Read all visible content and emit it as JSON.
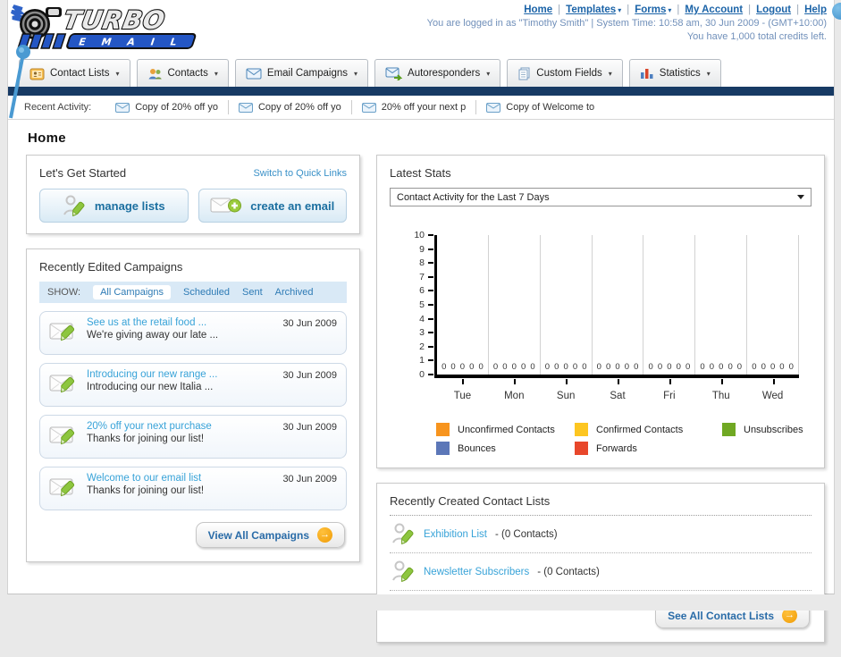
{
  "logo": {
    "line1": "TURBO",
    "line2": "E M A I L"
  },
  "header": {
    "links": [
      {
        "label": "Home",
        "dropdown": false
      },
      {
        "label": "Templates",
        "dropdown": true
      },
      {
        "label": "Forms",
        "dropdown": true
      },
      {
        "label": "My Account",
        "dropdown": false
      },
      {
        "label": "Logout",
        "dropdown": false
      },
      {
        "label": "Help",
        "dropdown": false
      }
    ],
    "login_info": "You are logged in as \"Timothy Smith\" | System Time: 10:58 am, 30 Jun 2009 - (GMT+10:00)",
    "credits": "You have 1,000 total credits left."
  },
  "nav": {
    "tabs": [
      {
        "label": "Contact Lists",
        "icon": "contact-lists-icon"
      },
      {
        "label": "Contacts",
        "icon": "contacts-icon"
      },
      {
        "label": "Email Campaigns",
        "icon": "email-campaigns-icon"
      },
      {
        "label": "Autoresponders",
        "icon": "autoresponders-icon"
      },
      {
        "label": "Custom Fields",
        "icon": "custom-fields-icon"
      },
      {
        "label": "Statistics",
        "icon": "statistics-icon"
      }
    ]
  },
  "recent_activity": {
    "label": "Recent Activity:",
    "items": [
      "Copy of 20% off yo",
      "Copy of 20% off yo",
      "20% off your next p",
      "Copy of Welcome to"
    ]
  },
  "home": {
    "title": "Home"
  },
  "get_started": {
    "title": "Let's Get Started",
    "switch_link": "Switch to Quick Links",
    "buttons": [
      {
        "label": "manage lists",
        "icon": "manage-lists-icon"
      },
      {
        "label": "create an email",
        "icon": "create-email-icon"
      }
    ]
  },
  "campaigns": {
    "title": "Recently Edited Campaigns",
    "show_label": "SHOW:",
    "filters": [
      {
        "label": "All Campaigns",
        "active": true
      },
      {
        "label": "Scheduled",
        "active": false
      },
      {
        "label": "Sent",
        "active": false
      },
      {
        "label": "Archived",
        "active": false
      }
    ],
    "items": [
      {
        "title": "See us at the retail food ...",
        "subtitle": "We're giving away our late ...",
        "date": "30 Jun 2009"
      },
      {
        "title": "Introducing our new range ...",
        "subtitle": "Introducing our new Italia ...",
        "date": "30 Jun 2009"
      },
      {
        "title": "20% off your next purchase",
        "subtitle": "Thanks for joining our list!",
        "date": "30 Jun 2009"
      },
      {
        "title": "Welcome to our email list",
        "subtitle": "Thanks for joining our list!",
        "date": "30 Jun 2009"
      }
    ],
    "view_all_label": "View All Campaigns"
  },
  "stats": {
    "title": "Latest Stats",
    "dropdown_value": "Contact Activity for the Last 7 Days"
  },
  "chart_data": {
    "type": "bar",
    "title": "Contact Activity for the Last 7 Days",
    "categories": [
      "Tue",
      "Mon",
      "Sun",
      "Sat",
      "Fri",
      "Thu",
      "Wed"
    ],
    "series": [
      {
        "name": "Unconfirmed Contacts",
        "color": "#F7941E",
        "values": [
          0,
          0,
          0,
          0,
          0,
          0,
          0
        ]
      },
      {
        "name": "Confirmed Contacts",
        "color": "#FDC621",
        "values": [
          0,
          0,
          0,
          0,
          0,
          0,
          0
        ]
      },
      {
        "name": "Unsubscribes",
        "color": "#70A823",
        "values": [
          0,
          0,
          0,
          0,
          0,
          0,
          0
        ]
      },
      {
        "name": "Bounces",
        "color": "#5C77B8",
        "values": [
          0,
          0,
          0,
          0,
          0,
          0,
          0
        ]
      },
      {
        "name": "Forwards",
        "color": "#E8472B",
        "values": [
          0,
          0,
          0,
          0,
          0,
          0,
          0
        ]
      }
    ],
    "xlabel": "",
    "ylabel": "",
    "ylim": [
      0,
      10
    ],
    "yticks": [
      0,
      1,
      2,
      3,
      4,
      5,
      6,
      7,
      8,
      9,
      10
    ],
    "grid": true,
    "legend_position": "bottom"
  },
  "contact_lists": {
    "title": "Recently Created Contact Lists",
    "items": [
      {
        "name": "Exhibition List",
        "count": "- (0 Contacts)"
      },
      {
        "name": "Newsletter Subscribers",
        "count": "- (0 Contacts)"
      }
    ],
    "see_all_label": "See All Contact Lists"
  }
}
